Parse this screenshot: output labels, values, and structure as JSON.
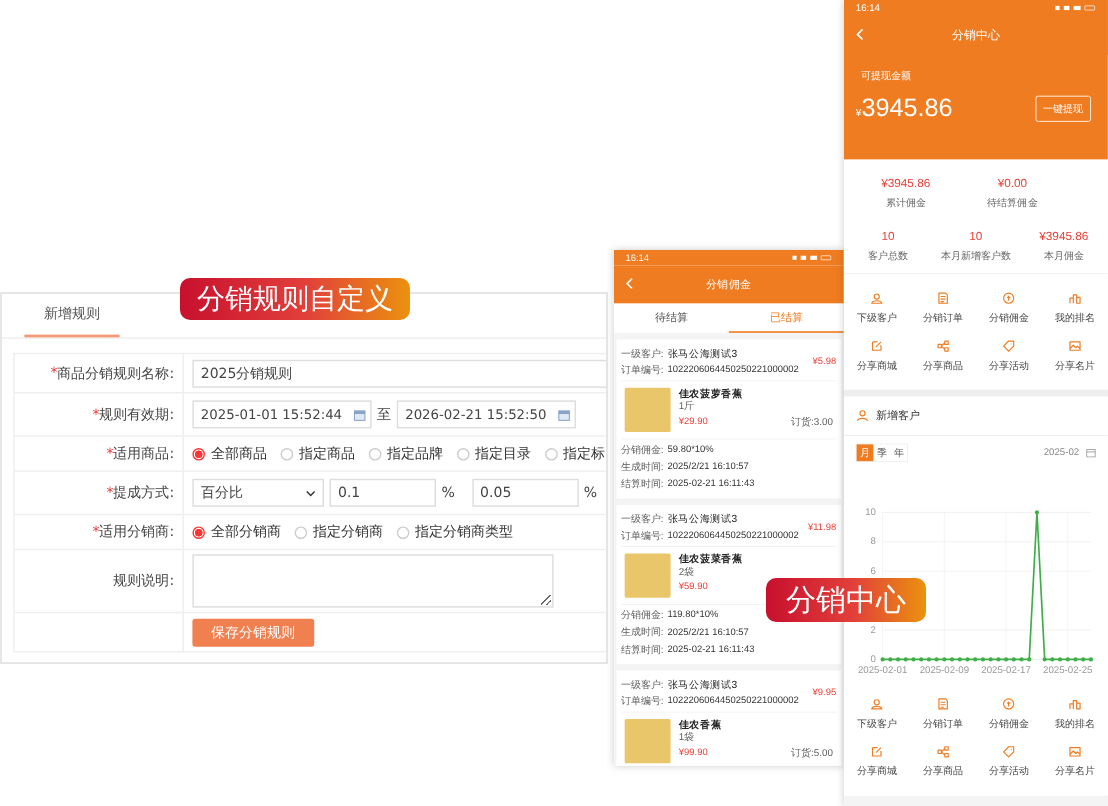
{
  "rule_form": {
    "banner": "分销规则自定义",
    "tab": "新增规则",
    "fields": [
      {
        "kind": "text",
        "required_mark": "*",
        "label": "商品分销规则名称:",
        "value": "2025分销规则"
      },
      {
        "kind": "daterange",
        "required_mark": "*",
        "label": "规则有效期:",
        "start": "2025-01-01 15:52:44",
        "separator": "至",
        "end": "2026-02-21 15:52:50"
      },
      {
        "kind": "radio",
        "required_mark": "*",
        "label": "适用商品:",
        "options": [
          {
            "label": "全部商品",
            "selected": true
          },
          {
            "label": "指定商品",
            "selected": false
          },
          {
            "label": "指定品牌",
            "selected": false
          },
          {
            "label": "指定目录",
            "selected": false
          },
          {
            "label": "指定标",
            "selected": false
          }
        ]
      },
      {
        "kind": "commission",
        "required_mark": "*",
        "label": "提成方式:",
        "select": "百分比",
        "inputs": [
          {
            "value": "0.1",
            "unit": "%"
          },
          {
            "value": "0.05",
            "unit": "%"
          }
        ]
      },
      {
        "kind": "radio",
        "required_mark": "*",
        "label": "适用分销商:",
        "options": [
          {
            "label": "全部分销商",
            "selected": true
          },
          {
            "label": "指定分销商",
            "selected": false
          },
          {
            "label": "指定分销商类型",
            "selected": false
          }
        ]
      },
      {
        "kind": "textarea",
        "label": "规则说明:"
      }
    ],
    "submit": "保存分销规则"
  },
  "commission_phone": {
    "status_time": "16:14",
    "title": "分销佣金",
    "tabs": [
      {
        "label": "待结算",
        "selected": false
      },
      {
        "label": "已结算",
        "selected": true
      }
    ],
    "orders": [
      {
        "customer_label": "一级客户:",
        "customer": "张马公海测试3",
        "order_label": "订单编号:",
        "order_no": "1022206064450250221000002",
        "amount": "¥5.98",
        "product": {
          "name": "佳农菠萝香蕉",
          "spec": "1斤",
          "price": "¥29.90",
          "quantity": "订货:3.00"
        },
        "details": [
          {
            "label": "分销佣金:",
            "value": "59.80*10%"
          },
          {
            "label": "生成时间:",
            "value": "2025/2/21 16:10:57"
          },
          {
            "label": "结算时间:",
            "value": "2025-02-21 16:11:43"
          }
        ]
      },
      {
        "customer_label": "一级客户:",
        "customer": "张马公海测试3",
        "order_label": "订单编号:",
        "order_no": "1022206064450250221000002",
        "amount": "¥11.98",
        "product": {
          "name": "佳农菠菜香蕉",
          "spec": "2袋",
          "price": "¥59.90"
        },
        "details": [
          {
            "label": "分销佣金:",
            "value": "119.80*10%"
          },
          {
            "label": "生成时间:",
            "value": "2025/2/21 16:10:57"
          },
          {
            "label": "结算时间:",
            "value": "2025-02-21 16:11:43"
          }
        ]
      },
      {
        "customer_label": "一级客户:",
        "customer": "张马公海测试3",
        "order_label": "订单编号:",
        "order_no": "1022206064450250221000002",
        "amount": "¥9.95",
        "product": {
          "name": "佳农香蕉",
          "spec": "1袋",
          "price": "¥99.90",
          "quantity": "订货:5.00"
        }
      }
    ]
  },
  "center_phone": {
    "banner": "分销中心",
    "status_time": "16:14",
    "title": "分销中心",
    "balance_label": "可提现金额",
    "currency": "¥",
    "balance": "3945.86",
    "withdraw_button": "一键提现",
    "stats_top": [
      {
        "value": "¥3945.86",
        "label": "累计佣金"
      },
      {
        "value": "¥0.00",
        "label": "待结算佣金"
      }
    ],
    "stats_bottom": [
      {
        "value": "10",
        "label": "客户总数"
      },
      {
        "value": "10",
        "label": "本月新增客户数"
      },
      {
        "value": "¥3945.86",
        "label": "本月佣金"
      }
    ],
    "menu": [
      "下级客户",
      "分销订单",
      "分销佣金",
      "我的排名",
      "分享商城",
      "分享商品",
      "分享活动",
      "分享名片"
    ],
    "new_customers": {
      "title": "新增客户",
      "periods": [
        {
          "label": "月",
          "selected": true
        },
        {
          "label": "季",
          "selected": false
        },
        {
          "label": "年",
          "selected": false
        }
      ],
      "month": "2025-02",
      "chart_data": {
        "type": "line",
        "categories": [
          "2025-02-01",
          null,
          null,
          null,
          null,
          null,
          null,
          null,
          "2025-02-09",
          null,
          null,
          null,
          null,
          null,
          null,
          null,
          "2025-02-17",
          null,
          null,
          null,
          null,
          null,
          null,
          null,
          "2025-02-25",
          null,
          null,
          null
        ],
        "series": [
          {
            "color": "#3fae49",
            "values": [
              0,
              0,
              0,
              0,
              0,
              0,
              0,
              0,
              0,
              0,
              0,
              0,
              0,
              0,
              0,
              0,
              0,
              0,
              0,
              0,
              10,
              0,
              0,
              0,
              0,
              0,
              0,
              0
            ]
          }
        ],
        "yticks": [
          0,
          2,
          6,
          8,
          10
        ],
        "ylim": [
          0,
          10
        ],
        "grid": true
      }
    },
    "menu_bottom": [
      "下级客户",
      "分销订单",
      "分销佣金",
      "我的排名",
      "分享商城",
      "分享商品",
      "分享活动",
      "分享名片"
    ]
  }
}
